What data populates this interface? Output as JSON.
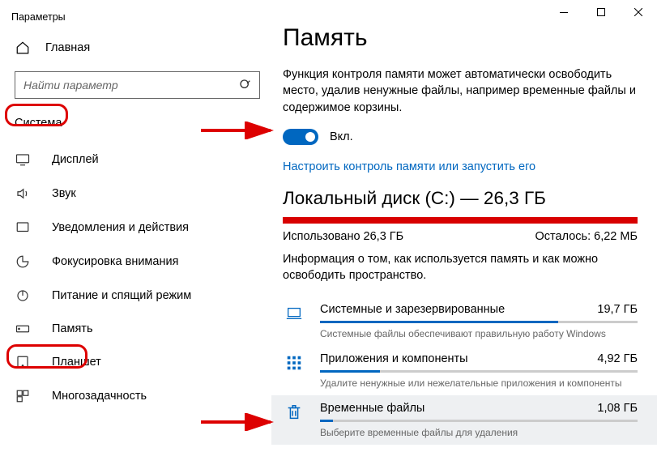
{
  "window": {
    "title": "Параметры"
  },
  "home": {
    "label": "Главная"
  },
  "search": {
    "placeholder": "Найти параметр"
  },
  "section": {
    "label": "Система"
  },
  "nav": [
    {
      "id": "display",
      "label": "Дисплей"
    },
    {
      "id": "sound",
      "label": "Звук"
    },
    {
      "id": "notifications",
      "label": "Уведомления и действия"
    },
    {
      "id": "focus",
      "label": "Фокусировка внимания"
    },
    {
      "id": "power",
      "label": "Питание и спящий режим"
    },
    {
      "id": "storage",
      "label": "Память"
    },
    {
      "id": "tablet",
      "label": "Планшет"
    },
    {
      "id": "multitask",
      "label": "Многозадачность"
    }
  ],
  "page": {
    "heading": "Память",
    "description": "Функция контроля памяти может автоматически освободить место, удалив ненужные файлы, например временные файлы и содержимое корзины.",
    "toggle_label": "Вкл.",
    "config_link": "Настроить контроль памяти или запустить его",
    "disk_title": "Локальный диск (C:) — 26,3 ГБ",
    "used": "Использовано 26,3 ГБ",
    "remaining": "Осталось: 6,22 МБ",
    "info": "Информация о том, как используется память и как можно освободить пространство."
  },
  "categories": [
    {
      "name": "Системные и зарезервированные",
      "size": "19,7 ГБ",
      "sub": "Системные файлы обеспечивают правильную работу Windows",
      "pct": 75
    },
    {
      "name": "Приложения и компоненты",
      "size": "4,92 ГБ",
      "sub": "Удалите ненужные или нежелательные приложения и компоненты",
      "pct": 19
    },
    {
      "name": "Временные файлы",
      "size": "1,08 ГБ",
      "sub": "Выберите временные файлы для удаления",
      "pct": 4
    }
  ]
}
